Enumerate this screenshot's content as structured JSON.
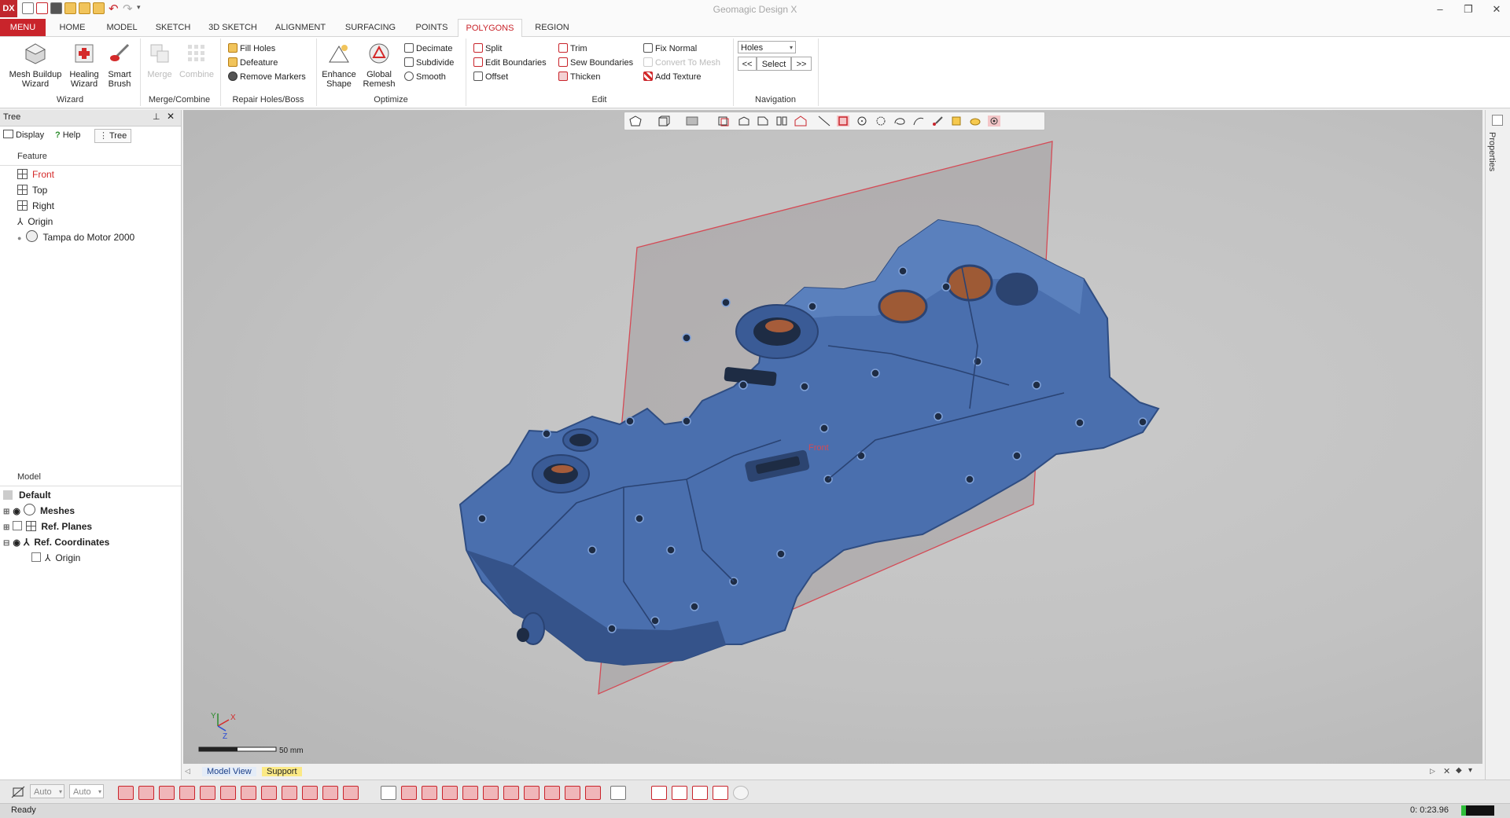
{
  "app": {
    "title": "Geomagic Design X",
    "logo_text": "DX"
  },
  "quick_access": [
    "new-icon",
    "open-icon",
    "save-icon",
    "import-icon",
    "export-icon",
    "folder-icon",
    "undo-icon",
    "redo-icon",
    "dropdown-icon"
  ],
  "window_controls": {
    "minimize": "–",
    "restore": "❐",
    "close": "✕"
  },
  "tabs": [
    "MENU",
    "HOME",
    "MODEL",
    "SKETCH",
    "3D SKETCH",
    "ALIGNMENT",
    "SURFACING",
    "POINTS",
    "POLYGONS",
    "REGION"
  ],
  "active_tab": "POLYGONS",
  "ribbon": {
    "wizard": {
      "label": "Wizard",
      "mesh_buildup": "Mesh Buildup\nWizard",
      "healing": "Healing\nWizard",
      "smart_brush": "Smart\nBrush"
    },
    "merge": {
      "label": "Merge/Combine",
      "merge": "Merge",
      "combine": "Combine"
    },
    "repair": {
      "label": "Repair Holes/Boss",
      "fill_holes": "Fill Holes",
      "defeature": "Defeature",
      "remove_markers": "Remove Markers"
    },
    "optimize": {
      "label": "Optimize",
      "enhance_shape": "Enhance\nShape",
      "global_remesh": "Global\nRemesh",
      "decimate": "Decimate",
      "subdivide": "Subdivide",
      "smooth": "Smooth"
    },
    "edit": {
      "label": "Edit",
      "split": "Split",
      "edit_boundaries": "Edit Boundaries",
      "offset": "Offset",
      "trim": "Trim",
      "sew_boundaries": "Sew Boundaries",
      "thicken": "Thicken",
      "fix_normal": "Fix Normal",
      "convert_to_mesh": "Convert To Mesh",
      "add_texture": "Add Texture"
    },
    "navigation": {
      "label": "Navigation",
      "dropdown_value": "Holes",
      "prev": "<<",
      "select": "Select",
      "next": ">>"
    }
  },
  "left_panel": {
    "title": "Tree",
    "tabs": {
      "display": "Display",
      "help": "Help",
      "tree": "Tree"
    },
    "feature_header": "Feature",
    "features": [
      {
        "label": "Front",
        "icon": "plane-icon",
        "color": "#d42a2a"
      },
      {
        "label": "Top",
        "icon": "plane-icon",
        "color": "#222222"
      },
      {
        "label": "Right",
        "icon": "plane-icon",
        "color": "#222222"
      },
      {
        "label": "Origin",
        "icon": "coord-icon",
        "color": "#222222"
      },
      {
        "label": "Tampa do Motor 2000",
        "icon": "mesh-icon",
        "color": "#222222"
      }
    ],
    "model_header": "Model",
    "model_items": [
      {
        "label": "Default",
        "bold": true
      },
      {
        "label": "Meshes",
        "bold": true
      },
      {
        "label": "Ref. Planes",
        "bold": true
      },
      {
        "label": "Ref. Coordinates",
        "bold": true
      },
      {
        "label": "Origin",
        "bold": false
      }
    ]
  },
  "viewport": {
    "plane_label": "Front",
    "scale_label": "50 mm",
    "axis_x": "X",
    "axis_y": "Y",
    "axis_z": "Z",
    "mesh_color": "#4a6fae",
    "plane_color": "#d44a55"
  },
  "right_strip": {
    "label": "Properties"
  },
  "bottom_tabs": {
    "model_view": "Model View",
    "support": "Support"
  },
  "bottom_toolbar": {
    "auto1": "Auto",
    "auto2": "Auto"
  },
  "status": {
    "left": "Ready",
    "right": "0: 0:23.96"
  }
}
